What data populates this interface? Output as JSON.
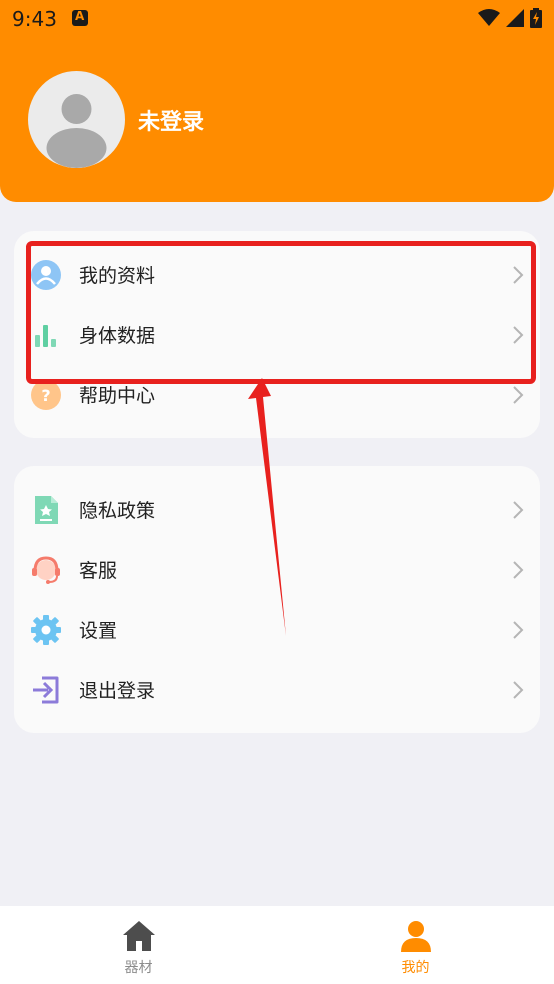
{
  "status_bar": {
    "time": "9:43"
  },
  "profile": {
    "name": "未登录"
  },
  "card1": {
    "items": [
      {
        "label": "我的资料",
        "icon": "user-profile-icon"
      },
      {
        "label": "身体数据",
        "icon": "bar-chart-icon"
      },
      {
        "label": "帮助中心",
        "icon": "help-question-icon"
      }
    ]
  },
  "card2": {
    "items": [
      {
        "label": "隐私政策",
        "icon": "privacy-policy-document-icon"
      },
      {
        "label": "客服",
        "icon": "customer-service-headset-icon"
      },
      {
        "label": "设置",
        "icon": "settings-gear-icon"
      },
      {
        "label": "退出登录",
        "icon": "logout-icon"
      }
    ]
  },
  "tabbar": {
    "tabs": [
      {
        "label": "器材",
        "icon": "home-icon",
        "active": false
      },
      {
        "label": "我的",
        "icon": "person-icon",
        "active": true
      }
    ]
  },
  "colors": {
    "accent": "#ff8c00",
    "annotation_red": "#e8211e",
    "background": "#f0f0f5",
    "card": "#fafafa"
  }
}
